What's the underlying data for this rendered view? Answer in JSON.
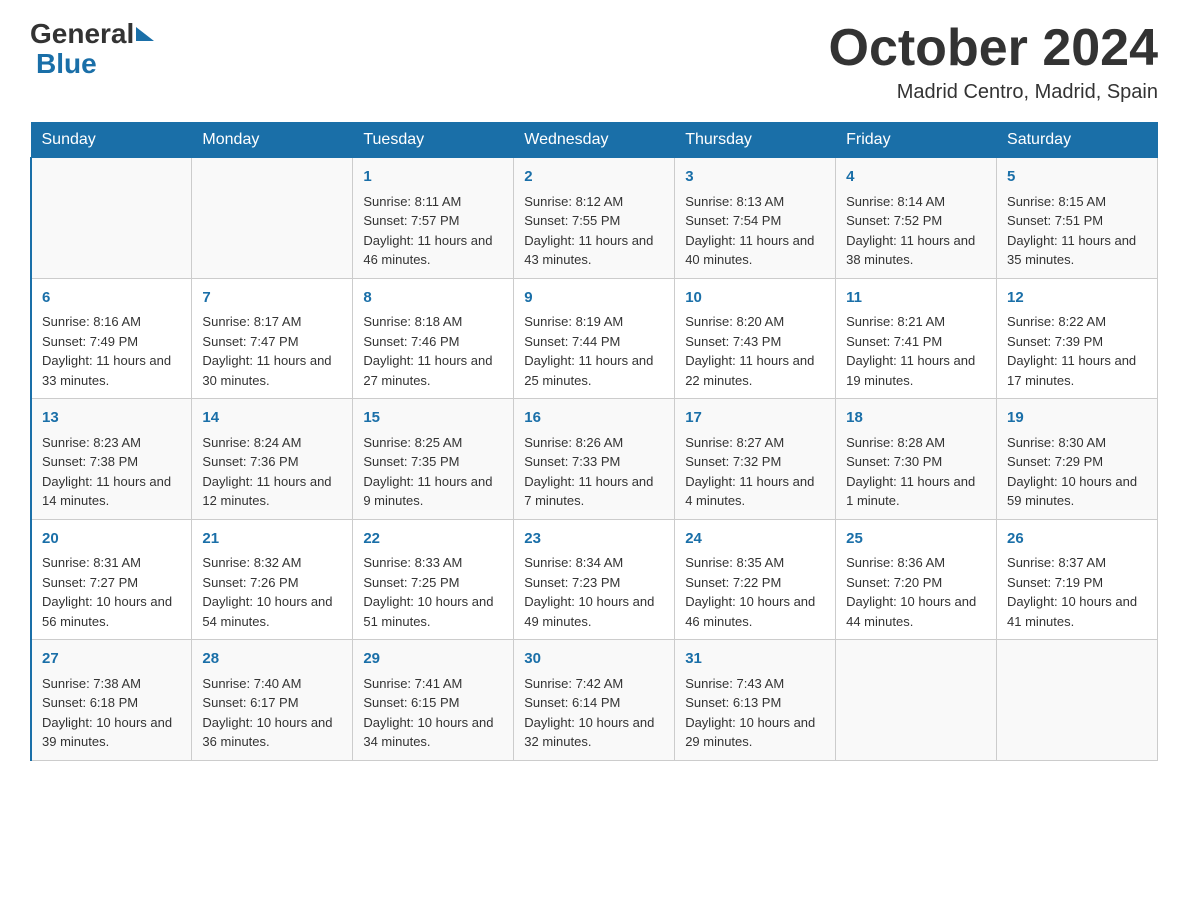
{
  "header": {
    "logo_general": "General",
    "logo_blue": "Blue",
    "month_year": "October 2024",
    "location": "Madrid Centro, Madrid, Spain"
  },
  "weekdays": [
    "Sunday",
    "Monday",
    "Tuesday",
    "Wednesday",
    "Thursday",
    "Friday",
    "Saturday"
  ],
  "weeks": [
    [
      {
        "day": "",
        "sunrise": "",
        "sunset": "",
        "daylight": ""
      },
      {
        "day": "",
        "sunrise": "",
        "sunset": "",
        "daylight": ""
      },
      {
        "day": "1",
        "sunrise": "Sunrise: 8:11 AM",
        "sunset": "Sunset: 7:57 PM",
        "daylight": "Daylight: 11 hours and 46 minutes."
      },
      {
        "day": "2",
        "sunrise": "Sunrise: 8:12 AM",
        "sunset": "Sunset: 7:55 PM",
        "daylight": "Daylight: 11 hours and 43 minutes."
      },
      {
        "day": "3",
        "sunrise": "Sunrise: 8:13 AM",
        "sunset": "Sunset: 7:54 PM",
        "daylight": "Daylight: 11 hours and 40 minutes."
      },
      {
        "day": "4",
        "sunrise": "Sunrise: 8:14 AM",
        "sunset": "Sunset: 7:52 PM",
        "daylight": "Daylight: 11 hours and 38 minutes."
      },
      {
        "day": "5",
        "sunrise": "Sunrise: 8:15 AM",
        "sunset": "Sunset: 7:51 PM",
        "daylight": "Daylight: 11 hours and 35 minutes."
      }
    ],
    [
      {
        "day": "6",
        "sunrise": "Sunrise: 8:16 AM",
        "sunset": "Sunset: 7:49 PM",
        "daylight": "Daylight: 11 hours and 33 minutes."
      },
      {
        "day": "7",
        "sunrise": "Sunrise: 8:17 AM",
        "sunset": "Sunset: 7:47 PM",
        "daylight": "Daylight: 11 hours and 30 minutes."
      },
      {
        "day": "8",
        "sunrise": "Sunrise: 8:18 AM",
        "sunset": "Sunset: 7:46 PM",
        "daylight": "Daylight: 11 hours and 27 minutes."
      },
      {
        "day": "9",
        "sunrise": "Sunrise: 8:19 AM",
        "sunset": "Sunset: 7:44 PM",
        "daylight": "Daylight: 11 hours and 25 minutes."
      },
      {
        "day": "10",
        "sunrise": "Sunrise: 8:20 AM",
        "sunset": "Sunset: 7:43 PM",
        "daylight": "Daylight: 11 hours and 22 minutes."
      },
      {
        "day": "11",
        "sunrise": "Sunrise: 8:21 AM",
        "sunset": "Sunset: 7:41 PM",
        "daylight": "Daylight: 11 hours and 19 minutes."
      },
      {
        "day": "12",
        "sunrise": "Sunrise: 8:22 AM",
        "sunset": "Sunset: 7:39 PM",
        "daylight": "Daylight: 11 hours and 17 minutes."
      }
    ],
    [
      {
        "day": "13",
        "sunrise": "Sunrise: 8:23 AM",
        "sunset": "Sunset: 7:38 PM",
        "daylight": "Daylight: 11 hours and 14 minutes."
      },
      {
        "day": "14",
        "sunrise": "Sunrise: 8:24 AM",
        "sunset": "Sunset: 7:36 PM",
        "daylight": "Daylight: 11 hours and 12 minutes."
      },
      {
        "day": "15",
        "sunrise": "Sunrise: 8:25 AM",
        "sunset": "Sunset: 7:35 PM",
        "daylight": "Daylight: 11 hours and 9 minutes."
      },
      {
        "day": "16",
        "sunrise": "Sunrise: 8:26 AM",
        "sunset": "Sunset: 7:33 PM",
        "daylight": "Daylight: 11 hours and 7 minutes."
      },
      {
        "day": "17",
        "sunrise": "Sunrise: 8:27 AM",
        "sunset": "Sunset: 7:32 PM",
        "daylight": "Daylight: 11 hours and 4 minutes."
      },
      {
        "day": "18",
        "sunrise": "Sunrise: 8:28 AM",
        "sunset": "Sunset: 7:30 PM",
        "daylight": "Daylight: 11 hours and 1 minute."
      },
      {
        "day": "19",
        "sunrise": "Sunrise: 8:30 AM",
        "sunset": "Sunset: 7:29 PM",
        "daylight": "Daylight: 10 hours and 59 minutes."
      }
    ],
    [
      {
        "day": "20",
        "sunrise": "Sunrise: 8:31 AM",
        "sunset": "Sunset: 7:27 PM",
        "daylight": "Daylight: 10 hours and 56 minutes."
      },
      {
        "day": "21",
        "sunrise": "Sunrise: 8:32 AM",
        "sunset": "Sunset: 7:26 PM",
        "daylight": "Daylight: 10 hours and 54 minutes."
      },
      {
        "day": "22",
        "sunrise": "Sunrise: 8:33 AM",
        "sunset": "Sunset: 7:25 PM",
        "daylight": "Daylight: 10 hours and 51 minutes."
      },
      {
        "day": "23",
        "sunrise": "Sunrise: 8:34 AM",
        "sunset": "Sunset: 7:23 PM",
        "daylight": "Daylight: 10 hours and 49 minutes."
      },
      {
        "day": "24",
        "sunrise": "Sunrise: 8:35 AM",
        "sunset": "Sunset: 7:22 PM",
        "daylight": "Daylight: 10 hours and 46 minutes."
      },
      {
        "day": "25",
        "sunrise": "Sunrise: 8:36 AM",
        "sunset": "Sunset: 7:20 PM",
        "daylight": "Daylight: 10 hours and 44 minutes."
      },
      {
        "day": "26",
        "sunrise": "Sunrise: 8:37 AM",
        "sunset": "Sunset: 7:19 PM",
        "daylight": "Daylight: 10 hours and 41 minutes."
      }
    ],
    [
      {
        "day": "27",
        "sunrise": "Sunrise: 7:38 AM",
        "sunset": "Sunset: 6:18 PM",
        "daylight": "Daylight: 10 hours and 39 minutes."
      },
      {
        "day": "28",
        "sunrise": "Sunrise: 7:40 AM",
        "sunset": "Sunset: 6:17 PM",
        "daylight": "Daylight: 10 hours and 36 minutes."
      },
      {
        "day": "29",
        "sunrise": "Sunrise: 7:41 AM",
        "sunset": "Sunset: 6:15 PM",
        "daylight": "Daylight: 10 hours and 34 minutes."
      },
      {
        "day": "30",
        "sunrise": "Sunrise: 7:42 AM",
        "sunset": "Sunset: 6:14 PM",
        "daylight": "Daylight: 10 hours and 32 minutes."
      },
      {
        "day": "31",
        "sunrise": "Sunrise: 7:43 AM",
        "sunset": "Sunset: 6:13 PM",
        "daylight": "Daylight: 10 hours and 29 minutes."
      },
      {
        "day": "",
        "sunrise": "",
        "sunset": "",
        "daylight": ""
      },
      {
        "day": "",
        "sunrise": "",
        "sunset": "",
        "daylight": ""
      }
    ]
  ]
}
